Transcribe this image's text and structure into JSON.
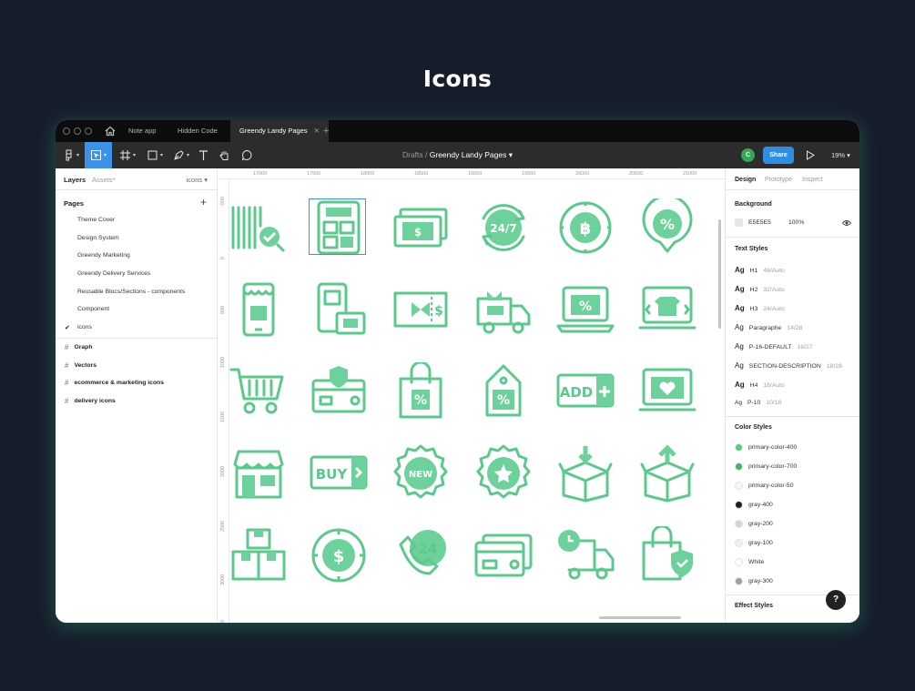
{
  "page_title": "Icons",
  "tabs": [
    {
      "label": "Note app",
      "active": false
    },
    {
      "label": "Hidden Code",
      "active": false
    },
    {
      "label": "Greendy Landy Pages",
      "active": true
    }
  ],
  "breadcrumb": {
    "parent": "Drafts",
    "separator": "/",
    "current": "Greendy Landy Pages"
  },
  "toolbar": {
    "avatar_initial": "C",
    "share_label": "Share",
    "zoom": "19%"
  },
  "left_panel": {
    "tab_layers": "Layers",
    "tab_assets": "Assets",
    "page_dropdown": "icons",
    "pages_title": "Pages",
    "pages": [
      "Theme Cover",
      "Design System",
      "Greendy Marketing",
      "Greendy Delivery Services",
      "Reusable Blocs/Sections - components",
      "Component",
      "icons"
    ],
    "layers": [
      "Graph",
      "Vectors",
      "ecommerce & marketing icons",
      "delivery icons"
    ]
  },
  "rulers": {
    "top": [
      "17000",
      "17500",
      "18000",
      "18500",
      "19000",
      "19500",
      "20000",
      "20500",
      "21000"
    ],
    "left": [
      "-500",
      "0",
      "500",
      "1000",
      "1500",
      "2000",
      "2500",
      "3000",
      "3500"
    ]
  },
  "canvas_icons": [
    "barcode-scan-icon",
    "calculator-icon",
    "cash-icon",
    "support-24-7-icon",
    "bitcoin-icon",
    "discount-location-icon",
    "mobile-shop-icon",
    "mobile-payment-icon",
    "gift-voucher-icon",
    "gift-delivery-truck-icon",
    "laptop-discount-icon",
    "laptop-shirt-icon",
    "shopping-cart-icon",
    "secure-card-icon",
    "shopping-bag-discount-icon",
    "price-tag-discount-icon",
    "add-tag-icon",
    "laptop-heart-icon",
    "store-icon",
    "buy-tag-icon",
    "new-badge-icon",
    "star-badge-icon",
    "box-download-icon",
    "box-upload-icon",
    "boxes-stack-icon",
    "dollar-coin-icon",
    "phone-24-icon",
    "credit-cards-icon",
    "delivery-truck-clock-icon",
    "shopping-bag-shield-icon"
  ],
  "icon_labels": {
    "support": "24/7",
    "add": "ADD",
    "buy": "BUY",
    "new": "NEW",
    "phone": "24"
  },
  "right_panel": {
    "tabs": [
      "Design",
      "Prototype",
      "Inspect"
    ],
    "background_title": "Background",
    "background_hex": "E5E5E5",
    "background_opacity": "100%",
    "text_styles_title": "Text Styles",
    "text_styles": [
      {
        "name": "H1",
        "spec": "48/Auto"
      },
      {
        "name": "H2",
        "spec": "32/Auto"
      },
      {
        "name": "H3",
        "spec": "24/Auto"
      },
      {
        "name": "Paragraphe",
        "spec": "14/28"
      },
      {
        "name": "P-16-DEFAULT",
        "spec": "16/27"
      },
      {
        "name": "SECTION-DESCRIPTION",
        "spec": "18/28"
      },
      {
        "name": "H4",
        "spec": "18/Auto"
      },
      {
        "name": "P-10",
        "spec": "10/18"
      }
    ],
    "color_styles_title": "Color Styles",
    "color_styles": [
      {
        "name": "primary-color-400",
        "hex": "#5dcb85"
      },
      {
        "name": "primary-color-700",
        "hex": "#42b46a"
      },
      {
        "name": "primary-color-50",
        "hex": "#f2faf4"
      },
      {
        "name": "gray-400",
        "hex": "#1a1f2c"
      },
      {
        "name": "gray-200",
        "hex": "#d2d4d8"
      },
      {
        "name": "gray-100",
        "hex": "#eeeff1"
      },
      {
        "name": "White",
        "hex": "#ffffff"
      },
      {
        "name": "gray-300",
        "hex": "#9aa0a9"
      }
    ],
    "effect_styles_title": "Effect Styles"
  },
  "help_label": "?",
  "colors": {
    "accent": "#3d91e8",
    "icon_stroke": "#5cc98c",
    "icon_fill": "#6cd19a",
    "page_bg": "#161d2c"
  }
}
